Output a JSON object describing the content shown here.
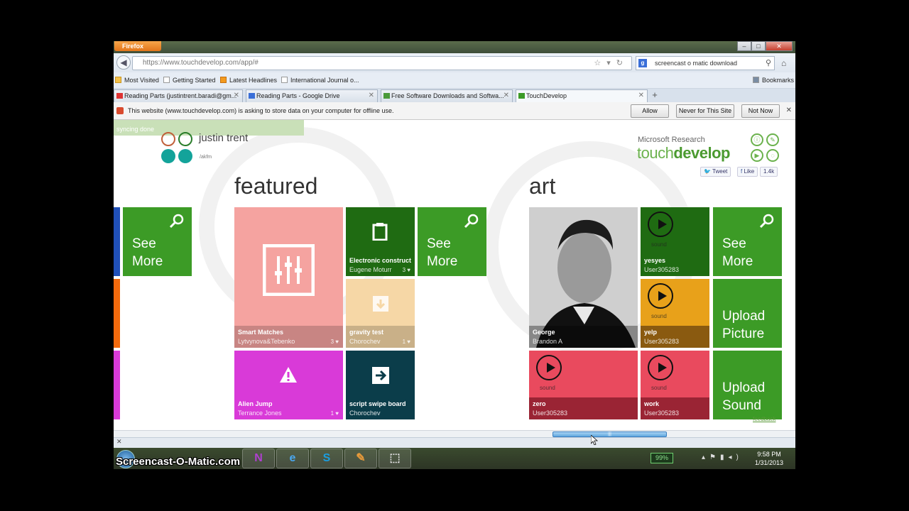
{
  "browser": {
    "firefox_label": "Firefox",
    "url": "https://www.touchdevelop.com/app/#",
    "search_query": "screencast o matic download"
  },
  "bookmarks": {
    "items": [
      "Most Visited",
      "Getting Started",
      "Latest Headlines",
      "International Journal o..."
    ],
    "right": "Bookmarks"
  },
  "tabs": [
    {
      "label": "Reading Parts (justintrent.baradi@gm..."
    },
    {
      "label": "Reading Parts - Google Drive"
    },
    {
      "label": "Free Software Downloads and Softwa..."
    },
    {
      "label": "TouchDevelop"
    }
  ],
  "notification": {
    "text": "This website (www.touchdevelop.com) is asking to store data on your computer for offline use.",
    "allow": "Allow",
    "never": "Never for This Site",
    "not_now": "Not Now"
  },
  "app": {
    "sync_status": "syncing done",
    "user_name": "justin trent",
    "user_id": "/akfm",
    "brand_top": "Microsoft Research",
    "brand_touch": "touch",
    "brand_develop": "develop",
    "tweet": "Tweet",
    "like": "Like",
    "like_count": "1.4k",
    "featured_title": "featured",
    "art_title": "art",
    "see_more_1": "See",
    "see_more_2": "More",
    "featured": {
      "smart": {
        "title": "Smart Matches",
        "author": "Lytvynova&Tebenko",
        "count": "3 ♥"
      },
      "electronic": {
        "title": "Electronic construct",
        "author": "Eugene Moturr",
        "count": "3 ♥"
      },
      "gravity": {
        "title": "gravity test",
        "author": "Chorochev",
        "count": "1 ♥"
      },
      "alien": {
        "title": "Alien Jump",
        "author": "Terrance Jones",
        "count": "1 ♥"
      },
      "swipe": {
        "title": "script swipe board",
        "author": "Chorochev"
      }
    },
    "art": {
      "george": {
        "title": "George",
        "author": "Brandon A"
      },
      "yesyes": {
        "title": "yesyes",
        "author": "User305283",
        "kind": "sound"
      },
      "yelp": {
        "title": "yelp",
        "author": "User305283",
        "kind": "sound"
      },
      "zero": {
        "title": "zero",
        "author": "User305283",
        "kind": "sound"
      },
      "work": {
        "title": "work",
        "author": "User305283",
        "kind": "sound"
      },
      "upload_picture_1": "Upload",
      "upload_picture_2": "Picture",
      "upload_sound_1": "Upload",
      "upload_sound_2": "Sound"
    },
    "feedback": "feedback"
  },
  "taskbar": {
    "battery": "99%",
    "time": "9:58 PM",
    "date": "1/31/2013"
  },
  "watermark": "Screencast-O-Matic.com",
  "colors": {
    "green_tile": "#3c9b26",
    "dark_green": "#1f6b12",
    "salmon": "#f5a3a0",
    "magenta": "#d93ad8",
    "dark_teal": "#0b3d4a",
    "peach": "#f6d7a6",
    "red": "#e94a5e",
    "orange": "#e8a11a"
  }
}
